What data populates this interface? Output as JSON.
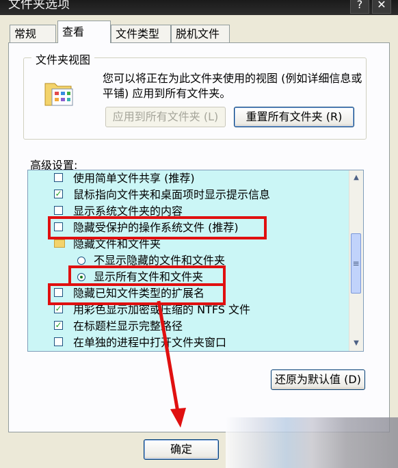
{
  "window": {
    "title": "文件夹选项",
    "help_icon": "?",
    "close_icon": "✕"
  },
  "tabs": [
    {
      "label": "常规"
    },
    {
      "label": "查看"
    },
    {
      "label": "文件类型"
    },
    {
      "label": "脱机文件"
    }
  ],
  "folder_views": {
    "group_title": "文件夹视图",
    "description": "您可以将正在为此文件夹使用的视图 (例如详细信息或平铺) 应用到所有文件夹。",
    "apply_all_button": "应用到所有文件夹 (L)",
    "reset_all_button": "重置所有文件夹 (R)"
  },
  "advanced": {
    "label": "高级设置:",
    "items": [
      {
        "label": "使用简单文件共享 (推荐)",
        "kind": "checkbox",
        "checked": false
      },
      {
        "label": "鼠标指向文件夹和桌面项时显示提示信息",
        "kind": "checkbox",
        "checked": true
      },
      {
        "label": "显示系统文件夹的内容",
        "kind": "checkbox",
        "checked": false
      },
      {
        "label": "隐藏受保护的操作系统文件 (推荐)",
        "kind": "checkbox",
        "checked": false
      },
      {
        "label": "隐藏文件和文件夹",
        "kind": "folder"
      },
      {
        "label": "不显示隐藏的文件和文件夹",
        "kind": "radio",
        "selected": false
      },
      {
        "label": "显示所有文件和文件夹",
        "kind": "radio",
        "selected": true
      },
      {
        "label": "隐藏已知文件类型的扩展名",
        "kind": "checkbox",
        "checked": false
      },
      {
        "label": "用彩色显示加密或压缩的 NTFS 文件",
        "kind": "checkbox",
        "checked": true
      },
      {
        "label": "在标题栏显示完整路径",
        "kind": "checkbox",
        "checked": true
      },
      {
        "label": "在单独的进程中打开文件夹窗口",
        "kind": "checkbox",
        "checked": false
      }
    ],
    "restore_defaults_button": "还原为默认值 (D)"
  },
  "footer": {
    "ok_button": "确定"
  },
  "colors": {
    "highlight": "#e01010",
    "list_bg": "#cbf6f6",
    "dialog_bg": "#ece9d8"
  }
}
